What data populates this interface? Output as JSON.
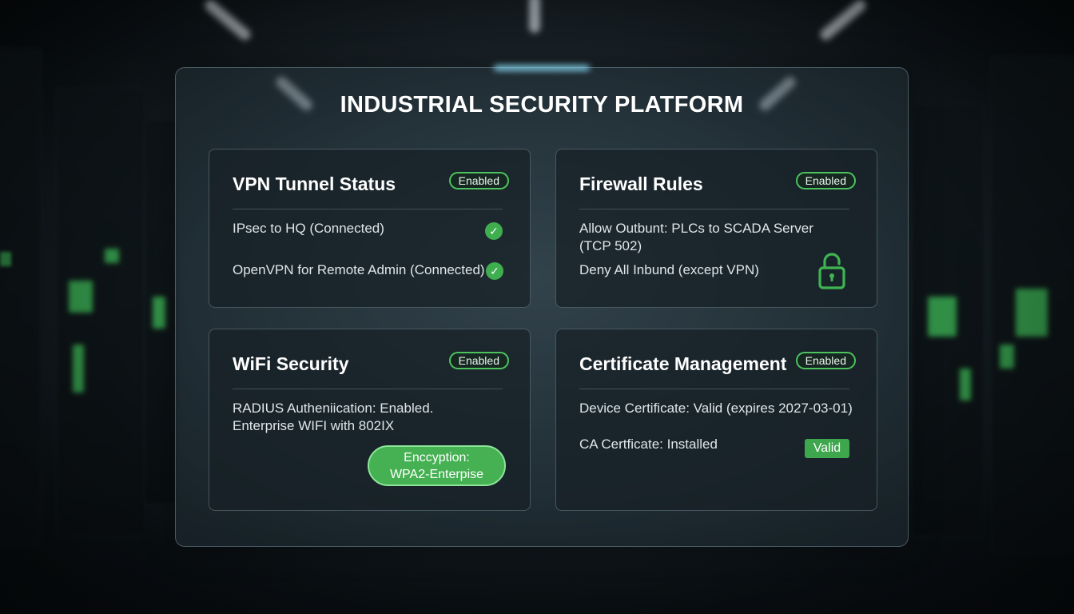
{
  "title": "INDUSTRIAL SECURITY PLATFORM",
  "colors": {
    "accent_green": "#45b152",
    "badge_border": "#4cc35e",
    "panel_bg": "#1f2a30"
  },
  "cards": {
    "vpn": {
      "title": "VPN Tunnel Status",
      "status": "Enabled",
      "items": [
        {
          "text": "IPsec to HQ (Connected)",
          "icon": "check-circle-icon"
        },
        {
          "text": "OpenVPN for Remote Admin (Connected)",
          "icon": "check-circle-icon"
        }
      ]
    },
    "firewall": {
      "title": "Firewall Rules",
      "status": "Enabled",
      "rules": [
        "Allow Outbunt: PLCs to SCADA Server",
        "(TCP 502)",
        "Deny All Inbund (except VPN)"
      ],
      "icon": "padlock-icon"
    },
    "wifi": {
      "title": "WiFi Security",
      "status": "Enabled",
      "lines": [
        "RADIUS Autheniication: Enabled.",
        "Enterprise WIFI with 802IX"
      ],
      "encryption_button": {
        "line1": "Enccyption:",
        "line2": "WPA2-Enterpise"
      }
    },
    "certificates": {
      "title": "Certificate Management",
      "status": "Enabled",
      "device_cert": "Device Certificate: Valid (expires 2027-03-01)",
      "ca_cert": "CA Certficate: Installed",
      "valid_badge": "Valid"
    }
  }
}
